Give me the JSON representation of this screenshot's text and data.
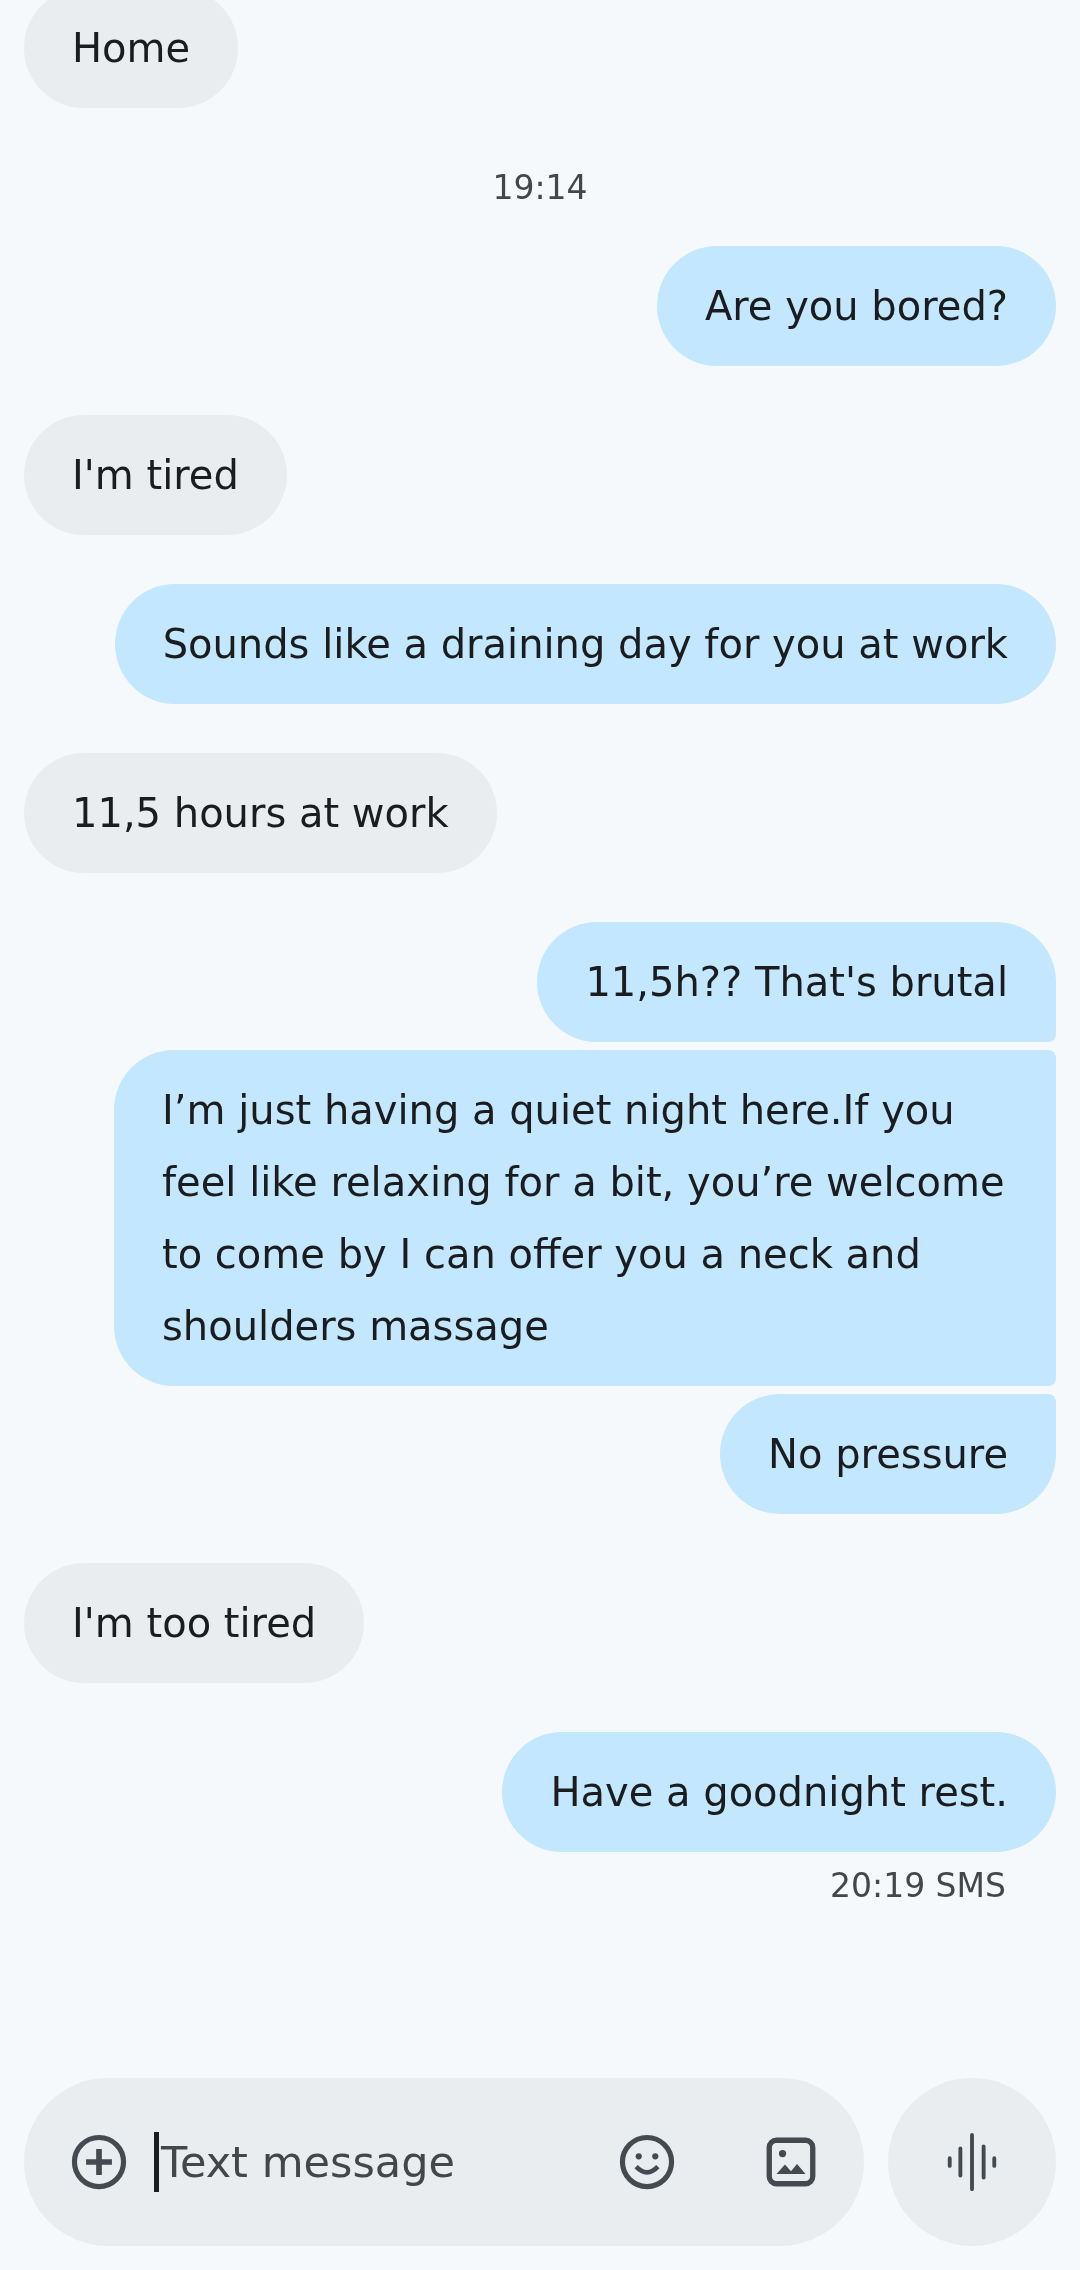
{
  "messages": [
    {
      "kind": "received",
      "text": "Home"
    },
    {
      "kind": "time",
      "text": "19:14"
    },
    {
      "kind": "sent",
      "text": "Are you bored?"
    },
    {
      "kind": "received",
      "text": "I'm tired"
    },
    {
      "kind": "sent",
      "text": "Sounds like a draining day for you at work"
    },
    {
      "kind": "received",
      "text": "11,5 hours at work"
    },
    {
      "kind": "sent",
      "text": "11,5h?? That's brutal"
    },
    {
      "kind": "sent",
      "text": "I’m just having a quiet night here.If you feel like relaxing for a bit, you’re welcome to come by I can offer you a neck and shoulders massage"
    },
    {
      "kind": "sent",
      "text": "No pressure"
    },
    {
      "kind": "received",
      "text": "I'm too tired"
    },
    {
      "kind": "sent",
      "text": "Have a goodnight rest."
    },
    {
      "kind": "status",
      "text": "20:19 SMS"
    }
  ],
  "composer": {
    "placeholder": "Text message",
    "focused": true
  }
}
